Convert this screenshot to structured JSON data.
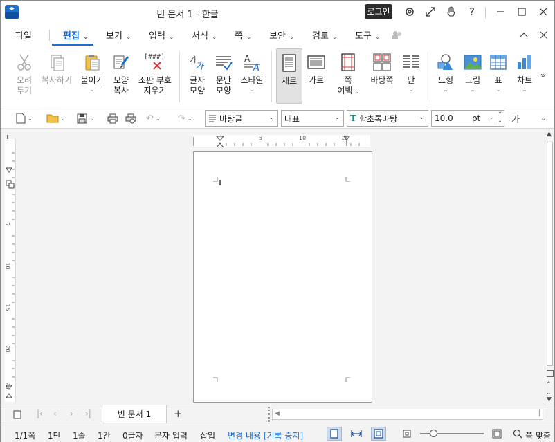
{
  "window": {
    "title": "빈 문서 1 - 한글",
    "login": "로그인"
  },
  "menu": {
    "file": "파일",
    "items": [
      {
        "label": "편집",
        "active": true
      },
      {
        "label": "보기"
      },
      {
        "label": "입력"
      },
      {
        "label": "서식"
      },
      {
        "label": "쪽"
      },
      {
        "label": "보안"
      },
      {
        "label": "검토"
      },
      {
        "label": "도구"
      }
    ]
  },
  "ribbon": {
    "cut": [
      "오려",
      "두기"
    ],
    "copy": "복사하기",
    "paste": "붙이기",
    "format_copy": [
      "모양",
      "복사"
    ],
    "clear_markup": [
      "조판 부호",
      "지우기"
    ],
    "clear_markup_icon_text": "[###]",
    "char_shape": [
      "글자",
      "모양"
    ],
    "para_shape": [
      "문단",
      "모양"
    ],
    "style": "스타일",
    "portrait": "세로",
    "landscape": "가로",
    "margins": [
      "쪽",
      "여백"
    ],
    "background": "바탕쪽",
    "columns": "단",
    "shapes": "도형",
    "picture": "그림",
    "table": "표",
    "chart": "차트"
  },
  "toolbar": {
    "style_value": "바탕글",
    "lang_value": "대표",
    "font_value": "함초롬바탕",
    "size_value": "10.0",
    "size_unit": "pt",
    "char_label": "가"
  },
  "ruler": {
    "h_marks": [
      "5",
      "10",
      "15"
    ],
    "v_marks": [
      "5",
      "10",
      "15",
      "20",
      "25"
    ]
  },
  "tabs": {
    "doc_tab": "빈 문서 1",
    "add": "+"
  },
  "status": {
    "page": "1/1쪽",
    "section": "1단",
    "line": "1줄",
    "column": "1칸",
    "chars": "0글자",
    "input_mode": "문자 입력",
    "insert": "삽입",
    "track_changes": "변경 내용 [기록 중지]",
    "zoom": "쪽 맞춤"
  },
  "colors": {
    "accent": "#1a6fcf",
    "titlebar": "#ffffff",
    "workarea": "#f3f3f3"
  }
}
